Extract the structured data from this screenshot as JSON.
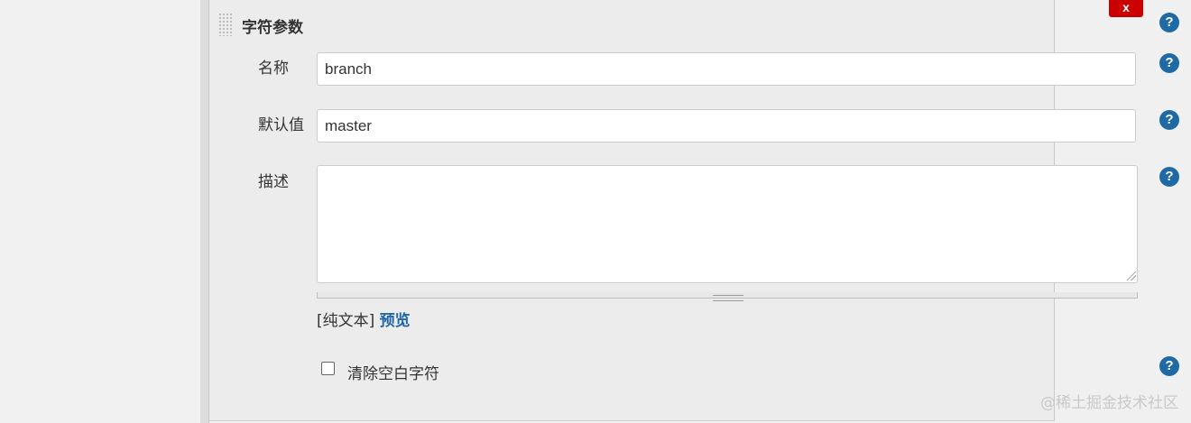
{
  "section": {
    "title": "字符参数"
  },
  "delete_label": "x",
  "fields": {
    "name": {
      "label": "名称",
      "value": "branch"
    },
    "default": {
      "label": "默认值",
      "value": "master"
    },
    "description": {
      "label": "描述",
      "value": ""
    }
  },
  "format": {
    "plain": "[纯文本]",
    "preview": "预览"
  },
  "trim": {
    "label": "清除空白字符",
    "checked": false
  },
  "help_glyph": "?",
  "watermark": "@稀土掘金技术社区",
  "colors": {
    "delete": "#cc0000",
    "help": "#1f6aa5",
    "link": "#2167a8"
  },
  "icons": [
    "drag-handle-icon",
    "help-icon",
    "close-icon"
  ]
}
